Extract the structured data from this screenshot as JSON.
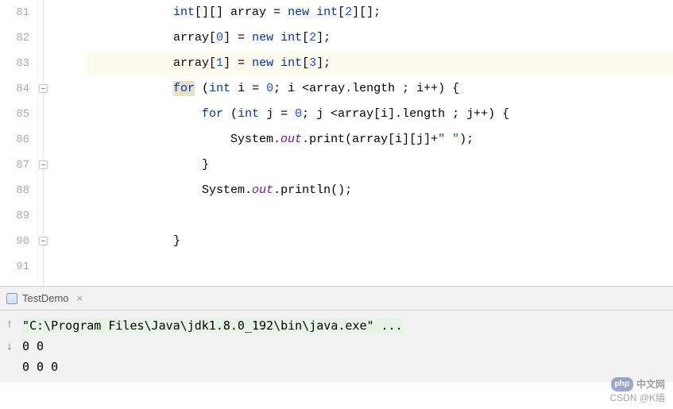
{
  "editor": {
    "first_line": 81,
    "highlighted_line": 83,
    "lines": [
      {
        "n": 81,
        "indent": "            ",
        "tokens": [
          {
            "t": "int",
            "c": "kw"
          },
          {
            "t": "[][] array = "
          },
          {
            "t": "new ",
            "c": "kw"
          },
          {
            "t": "int",
            "c": "kw"
          },
          {
            "t": "["
          },
          {
            "t": "2",
            "c": "num"
          },
          {
            "t": "][];"
          }
        ]
      },
      {
        "n": 82,
        "indent": "            ",
        "tokens": [
          {
            "t": "array["
          },
          {
            "t": "0",
            "c": "num"
          },
          {
            "t": "] = "
          },
          {
            "t": "new ",
            "c": "kw"
          },
          {
            "t": "int",
            "c": "kw"
          },
          {
            "t": "["
          },
          {
            "t": "2",
            "c": "num"
          },
          {
            "t": "];"
          }
        ]
      },
      {
        "n": 83,
        "indent": "            ",
        "tokens": [
          {
            "t": "array["
          },
          {
            "t": "1",
            "c": "num"
          },
          {
            "t": "] = "
          },
          {
            "t": "new ",
            "c": "kw"
          },
          {
            "t": "int",
            "c": "kw"
          },
          {
            "t": "["
          },
          {
            "t": "3",
            "c": "num"
          },
          {
            "t": "];"
          }
        ]
      },
      {
        "n": 84,
        "indent": "            ",
        "tokens": [
          {
            "t": "for",
            "c": "kw",
            "hl": true
          },
          {
            "t": " ("
          },
          {
            "t": "int",
            "c": "kw"
          },
          {
            "t": " i = "
          },
          {
            "t": "0",
            "c": "num"
          },
          {
            "t": "; i <array.length ; i++) {"
          }
        ]
      },
      {
        "n": 85,
        "indent": "                ",
        "tokens": [
          {
            "t": "for ",
            "c": "kw"
          },
          {
            "t": "("
          },
          {
            "t": "int",
            "c": "kw"
          },
          {
            "t": " j = "
          },
          {
            "t": "0",
            "c": "num"
          },
          {
            "t": "; j <array[i].length ; j++) {"
          }
        ]
      },
      {
        "n": 86,
        "indent": "                    ",
        "tokens": [
          {
            "t": "System."
          },
          {
            "t": "out",
            "c": "field"
          },
          {
            "t": ".print(array[i][j]+"
          },
          {
            "t": "\" \"",
            "c": "str"
          },
          {
            "t": ");"
          }
        ]
      },
      {
        "n": 87,
        "indent": "                ",
        "tokens": [
          {
            "t": "}"
          }
        ]
      },
      {
        "n": 88,
        "indent": "                ",
        "tokens": [
          {
            "t": "System."
          },
          {
            "t": "out",
            "c": "field"
          },
          {
            "t": ".println();"
          }
        ]
      },
      {
        "n": 89,
        "indent": "",
        "tokens": []
      },
      {
        "n": 90,
        "indent": "            ",
        "tokens": [
          {
            "t": "}"
          }
        ]
      },
      {
        "n": 91,
        "indent": "",
        "tokens": []
      }
    ],
    "fold_markers": [
      84,
      87,
      90
    ]
  },
  "run_tab": {
    "label": "TestDemo"
  },
  "console": {
    "command": "\"C:\\Program Files\\Java\\jdk1.8.0_192\\bin\\java.exe\" ...",
    "output": [
      "0 0",
      "0 0 0"
    ]
  },
  "gutter_icons": {
    "up": "↑",
    "down": "↓"
  },
  "watermark": {
    "brand": "中文网",
    "badge": "php",
    "credit": "CSDN @K嫱"
  }
}
